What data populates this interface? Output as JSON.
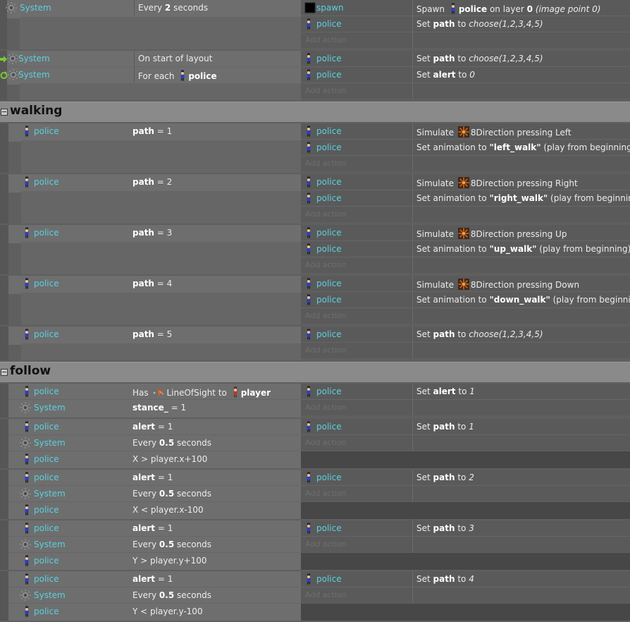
{
  "labels": {
    "add_action": "Add action",
    "groups": {
      "walking": "walking",
      "follow": "follow"
    }
  },
  "objects": {
    "system": "System",
    "police": "police",
    "spawn": "spawn",
    "player": "player"
  },
  "colors": {
    "object_link": "#5bd0e0",
    "group_header": "#8a8a8a",
    "text": "#ececec"
  },
  "icons": {
    "system": "gear-icon",
    "police": "police-sprite-icon",
    "spawn": "black-square-icon",
    "behavior": "8direction-behavior-icon",
    "los": "line-of-sight-icon",
    "player": "player-sprite-icon",
    "start": "arrow-right-icon",
    "foreach": "loop-arrow-icon"
  },
  "events": [
    {
      "conditions": [
        {
          "obj": "System",
          "icon": "gear",
          "text": "Every 2 seconds"
        }
      ],
      "actions": [
        {
          "obj": "spawn",
          "icon": "spawn",
          "text": "Spawn police on layer 0 (image point 0)"
        },
        {
          "obj": "police",
          "icon": "police",
          "text": "Set path to choose(1,2,3,4,5)"
        }
      ]
    },
    {
      "conditions": [
        {
          "obj": "System",
          "icon": "gear",
          "text": "On start of layout"
        },
        {
          "obj": "System",
          "icon": "gear",
          "text": "For each police"
        }
      ],
      "actions": [
        {
          "obj": "police",
          "icon": "police",
          "text": "Set path to choose(1,2,3,4,5)"
        },
        {
          "obj": "police",
          "icon": "police",
          "text": "Set alert to 0"
        }
      ]
    },
    {
      "group": "walking"
    },
    {
      "conditions": [
        {
          "obj": "police",
          "text": "path = 1"
        }
      ],
      "actions": [
        {
          "obj": "police",
          "text": "Simulate 8Direction pressing Left"
        },
        {
          "obj": "police",
          "text": "Set animation to \"left_walk\" (play from beginning)"
        }
      ]
    },
    {
      "conditions": [
        {
          "obj": "police",
          "text": "path = 2"
        }
      ],
      "actions": [
        {
          "obj": "police",
          "text": "Simulate 8Direction pressing Right"
        },
        {
          "obj": "police",
          "text": "Set animation to \"right_walk\" (play from beginning)"
        }
      ]
    },
    {
      "conditions": [
        {
          "obj": "police",
          "text": "path = 3"
        }
      ],
      "actions": [
        {
          "obj": "police",
          "text": "Simulate 8Direction pressing Up"
        },
        {
          "obj": "police",
          "text": "Set animation to \"up_walk\" (play from beginning)"
        }
      ]
    },
    {
      "conditions": [
        {
          "obj": "police",
          "text": "path = 4"
        }
      ],
      "actions": [
        {
          "obj": "police",
          "text": "Simulate 8Direction pressing Down"
        },
        {
          "obj": "police",
          "text": "Set animation to \"down_walk\" (play from beginning)"
        }
      ]
    },
    {
      "conditions": [
        {
          "obj": "police",
          "text": "path = 5"
        }
      ],
      "actions": [
        {
          "obj": "police",
          "text": "Set path to choose(1,2,3,4,5)"
        }
      ]
    },
    {
      "group": "follow"
    },
    {
      "conditions": [
        {
          "obj": "police",
          "text": "Has LineOfSight to player"
        },
        {
          "obj": "System",
          "text": "stance_ = 1"
        }
      ],
      "actions": [
        {
          "obj": "police",
          "text": "Set alert to 1"
        }
      ]
    },
    {
      "conditions": [
        {
          "obj": "police",
          "text": "alert = 1"
        },
        {
          "obj": "System",
          "text": "Every 0.5 seconds"
        },
        {
          "obj": "police",
          "text": "X > player.x+100"
        }
      ],
      "actions": [
        {
          "obj": "police",
          "text": "Set path to 1"
        }
      ]
    },
    {
      "conditions": [
        {
          "obj": "police",
          "text": "alert = 1"
        },
        {
          "obj": "System",
          "text": "Every 0.5 seconds"
        },
        {
          "obj": "police",
          "text": "X < player.x-100"
        }
      ],
      "actions": [
        {
          "obj": "police",
          "text": "Set path to 2"
        }
      ]
    },
    {
      "conditions": [
        {
          "obj": "police",
          "text": "alert = 1"
        },
        {
          "obj": "System",
          "text": "Every 0.5 seconds"
        },
        {
          "obj": "police",
          "text": "Y > player.y+100"
        }
      ],
      "actions": [
        {
          "obj": "police",
          "text": "Set path to 3"
        }
      ]
    },
    {
      "conditions": [
        {
          "obj": "police",
          "text": "alert = 1"
        },
        {
          "obj": "System",
          "text": "Every 0.5 seconds"
        },
        {
          "obj": "police",
          "text": "Y < player.y-100"
        }
      ],
      "actions": [
        {
          "obj": "police",
          "text": "Set path to 4"
        }
      ]
    }
  ]
}
